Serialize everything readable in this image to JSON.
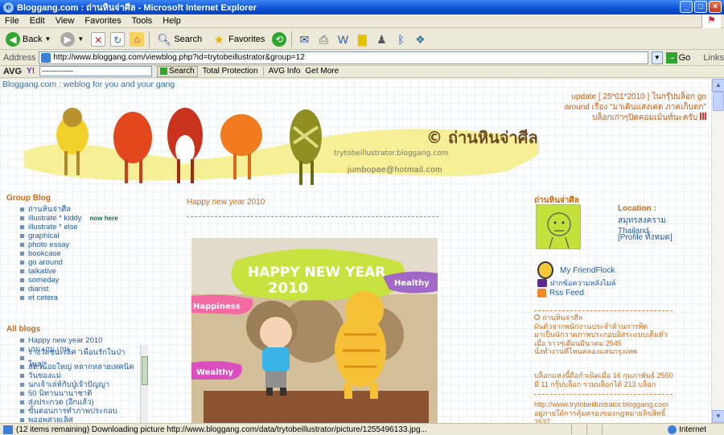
{
  "window": {
    "title": "Bloggang.com : ถ่านหินจ่าศีล - Microsoft Internet Explorer",
    "buttons": [
      "_",
      "□",
      "×"
    ]
  },
  "menu": [
    "File",
    "Edit",
    "View",
    "Favorites",
    "Tools",
    "Help"
  ],
  "toolbar": {
    "back": "Back",
    "search": "Search",
    "favorites": "Favorites"
  },
  "address": {
    "label": "Address",
    "url": "http://www.bloggang.com/viewblog.php?id=trytobeillustrator&group=12",
    "go": "Go",
    "links": "Links"
  },
  "avgbar": {
    "logo": "AVG",
    "search_placeholder": "-------------",
    "search_btn": "Search",
    "protection": "Total Protection",
    "info": "AVG Info",
    "getmore": "Get More"
  },
  "page": {
    "tagline": "Bloggang.com : weblog for you and your gang",
    "update": "update [ 25*01*2010 ] ในกรุ๊ปบล็อก go around เรื่อง \"มาเดินแสงเดด ภาคเก็บตก\" บล็อกเก่าๆปิดคอมเม้นท์นะครับ",
    "banner_title": "© ถ่านหินจ่าศีล",
    "banner_sub": "trytobeillustrator.bloggang.com",
    "email": "jumbopae@hotmail.com",
    "group_title": "Group Blog",
    "groups": [
      {
        "label": "ถ่านหินจ่าศีล",
        "badge": ""
      },
      {
        "label": "illustrate * kiddy",
        "badge": "now here"
      },
      {
        "label": "illustrate * else",
        "badge": ""
      },
      {
        "label": "graphical",
        "badge": ""
      },
      {
        "label": "photo essay",
        "badge": ""
      },
      {
        "label": "bookcase",
        "badge": ""
      },
      {
        "label": "go around",
        "badge": ""
      },
      {
        "label": "talkative",
        "badge": ""
      },
      {
        "label": "someday",
        "badge": ""
      },
      {
        "label": "diarist",
        "badge": ""
      },
      {
        "label": "et cetera",
        "badge": ""
      }
    ],
    "allblogs_title": "All blogs",
    "allblogs": [
      "Happy new year 2010",
      "เกม เกม เกม",
      "รางวัลชนะเลิศ \"เพื่อนรักในป่าใหญ่\"",
      "สัตว์น้อยใหญ่ หลากหลายเทคนิค",
      "วันของแม่",
      "นกเจ้าเล่ห์กับปู่เจ้าปัญญา",
      "50 นิทานนานาชาติ",
      "ส่งประกวด (อีกแล้ว)",
      "ขั้นตอนการทำภาพประกอบ",
      "พออพสวยเลิศ"
    ],
    "post_title": "Happy new year 2010",
    "post_image_text": {
      "headline": "HAPPY NEW YEAR",
      "year": "2010",
      "healthy": "Healthy",
      "happiness": "Happiness",
      "wealthy": "Wealthy"
    },
    "profile_name": "ถ่านหินจ่าศีล",
    "location_label": "Location :",
    "location_value": "สมุทรสงคราม Thailand",
    "profile_link": "[Profile ทั้งหมด]",
    "flock_label": "My FriendFlock",
    "msg_label": "ฝากข้อความหลังไมค์",
    "rss_label": "Rss Feed",
    "about": "ถ่านหินจ่าศีล\nผันตัวจากพนักงานประจำด้านการพิต\nมาเป็นนักวาดภาพประกอบอิสระแบบเต็มตัว\nเมื่อ ราวๆเดือนมีนาคม 2545\nนั่งทำงานที่ไหนคลองแสนกรุงเทพ",
    "stats1": "บล็อกแห่งนี้ถือกำเนิดเมื่อ 16 กุมภาพันธ์ 2550",
    "stats2": "มี 11 กรุ๊ปบล็อก รวมบล็อกได้ 213 บล็อก",
    "site_url": "http://www.trytobeillustrator.bloggang.com",
    "copyright": "อยู่ภายใต้การคุ้มครองของกฎหมายลิขสิทธิ์ 2537"
  },
  "status": {
    "text": "(12 items remaining) Downloading picture http://www.bloggang.com/data/trytobeillustrator/picture/1255496133.jpg...",
    "zone": "Internet"
  },
  "colors": {
    "accent_orange": "#d06a12",
    "link_blue": "#1f5aa6",
    "xp_blue": "#0a4fd1"
  }
}
